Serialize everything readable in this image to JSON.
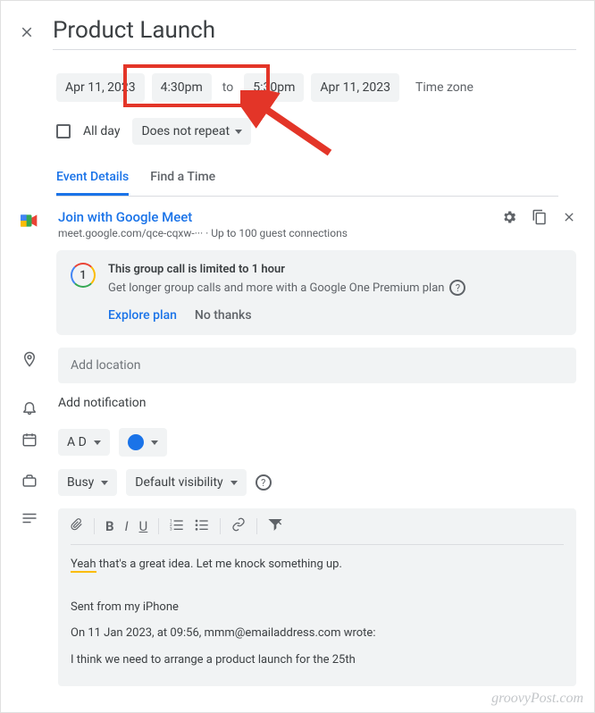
{
  "header": {
    "title": "Product Launch"
  },
  "datetime": {
    "start_date": "Apr 11, 2023",
    "start_time": "4:30pm",
    "to": "to",
    "end_time": "5:30pm",
    "end_date": "Apr 11, 2023",
    "timezone_label": "Time zone"
  },
  "allday": {
    "label": "All day",
    "repeat": "Does not repeat"
  },
  "tabs": {
    "details": "Event Details",
    "find": "Find a Time"
  },
  "meet": {
    "link_label": "Join with Google Meet",
    "sub": "meet.google.com/qce-cqxw-···   · Up to 100 guest connections"
  },
  "info_card": {
    "badge": "1",
    "title": "This group call is limited to 1 hour",
    "sub": "Get longer group calls and more with a Google One Premium plan",
    "explore": "Explore plan",
    "no_thanks": "No thanks"
  },
  "location": {
    "placeholder": "Add location"
  },
  "notification": {
    "label": "Add notification"
  },
  "calendar_select": {
    "owner": "A D"
  },
  "availability": {
    "busy": "Busy",
    "visibility": "Default visibility"
  },
  "description": {
    "line1_hl": "Yeah",
    "line1_rest": " that's a great idea. Let me knock something up.",
    "line2": "Sent from my iPhone",
    "line3": "On 11 Jan 2023, at 09:56, mmm@emailaddress.com wrote:",
    "line4": "I think we need to arrange a product launch for the 25th"
  },
  "watermark": "groovyPost.com"
}
